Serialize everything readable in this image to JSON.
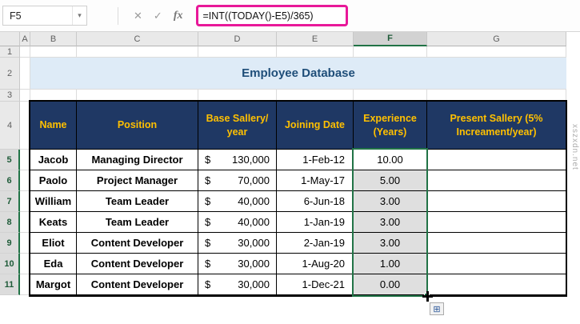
{
  "toolbar": {
    "name_box": "F5",
    "chevron_icon": "▾",
    "cancel_icon": "✕",
    "enter_icon": "✓",
    "fx_icon": "fx",
    "formula": "=INT((TODAY()-E5)/365)"
  },
  "columns": [
    "A",
    "B",
    "C",
    "D",
    "E",
    "F",
    "G"
  ],
  "row_numbers": [
    "1",
    "2",
    "3",
    "4",
    "5",
    "6",
    "7",
    "8",
    "9",
    "10",
    "11"
  ],
  "title": "Employee Database",
  "table": {
    "headers": {
      "name": "Name",
      "position": "Position",
      "base_salary": "Base Sallery/ year",
      "joining_date": "Joining Date",
      "experience": "Experience (Years)",
      "present_salary": "Present Sallery (5% Increament/year)"
    },
    "rows": [
      {
        "name": "Jacob",
        "position": "Managing Director",
        "cur": "$",
        "salary": "130,000",
        "date": "1-Feb-12",
        "exp": "10.00"
      },
      {
        "name": "Paolo",
        "position": "Project Manager",
        "cur": "$",
        "salary": "70,000",
        "date": "1-May-17",
        "exp": "5.00"
      },
      {
        "name": "William",
        "position": "Team Leader",
        "cur": "$",
        "salary": "40,000",
        "date": "6-Jun-18",
        "exp": "3.00"
      },
      {
        "name": "Keats",
        "position": "Team Leader",
        "cur": "$",
        "salary": "40,000",
        "date": "1-Jan-19",
        "exp": "3.00"
      },
      {
        "name": "Eliot",
        "position": "Content Developer",
        "cur": "$",
        "salary": "30,000",
        "date": "2-Jan-19",
        "exp": "3.00"
      },
      {
        "name": "Eda",
        "position": "Content Developer",
        "cur": "$",
        "salary": "30,000",
        "date": "1-Aug-20",
        "exp": "1.00"
      },
      {
        "name": "Margot",
        "position": "Content Developer",
        "cur": "$",
        "salary": "30,000",
        "date": "1-Dec-21",
        "exp": "0.00"
      }
    ]
  },
  "icons": {
    "autofill_glyph": "⊞"
  },
  "watermark": "xszxdn.net",
  "colors": {
    "header_bg": "#1F3864",
    "header_text": "#FFC000",
    "title_bg": "#DEEBF7",
    "title_text": "#1F4E79",
    "selection_green": "#217346",
    "formula_highlight": "#E81899"
  }
}
